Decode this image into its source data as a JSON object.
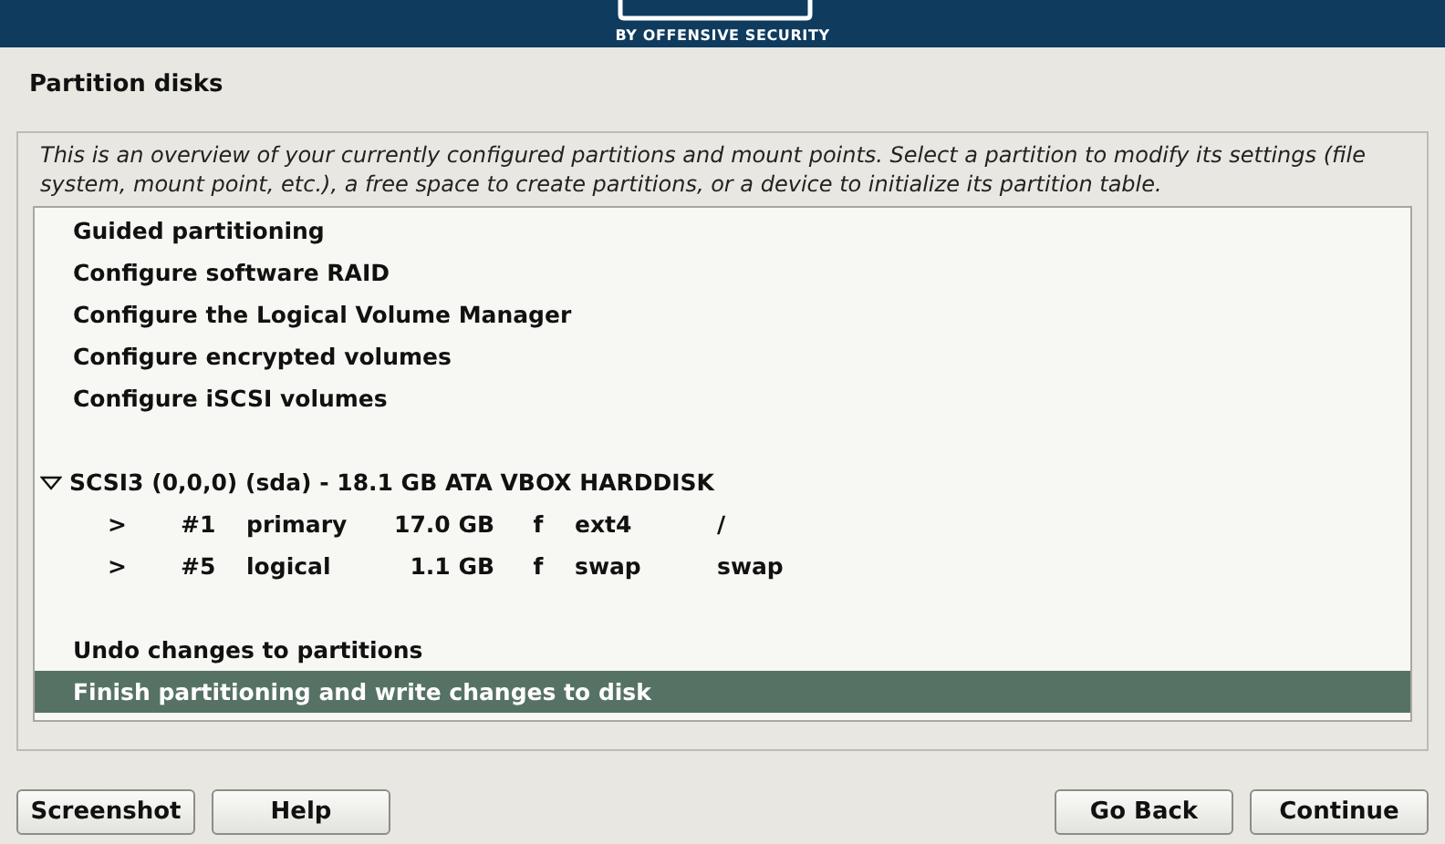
{
  "banner": {
    "tagline": "BY OFFENSIVE SECURITY"
  },
  "title": "Partition disks",
  "description": "This is an overview of your currently configured partitions and mount points. Select a partition to modify its settings (file system, mount point, etc.), a free space to create partitions, or a device to initialize its partition table.",
  "groups": [
    [
      {
        "kind": "option",
        "label": "Guided partitioning",
        "selected": false
      },
      {
        "kind": "option",
        "label": "Configure software RAID",
        "selected": false
      },
      {
        "kind": "option",
        "label": "Configure the Logical Volume Manager",
        "selected": false
      },
      {
        "kind": "option",
        "label": "Configure encrypted volumes",
        "selected": false
      },
      {
        "kind": "option",
        "label": "Configure iSCSI volumes",
        "selected": false
      }
    ],
    [
      {
        "kind": "disk",
        "label": "SCSI3 (0,0,0) (sda) - 18.1 GB ATA VBOX HARDDISK",
        "expanded": true,
        "selected": false,
        "children": [
          {
            "kind": "partition",
            "marker": ">",
            "number": "#1",
            "type": "primary",
            "size": "17.0 GB",
            "flag": "f",
            "filesystem": "ext4",
            "mount": "/",
            "selected": false
          },
          {
            "kind": "partition",
            "marker": ">",
            "number": "#5",
            "type": "logical",
            "size": "1.1 GB",
            "flag": "f",
            "filesystem": "swap",
            "mount": "swap",
            "selected": false
          }
        ]
      }
    ],
    [
      {
        "kind": "option",
        "label": "Undo changes to partitions",
        "selected": false
      },
      {
        "kind": "option",
        "label": "Finish partitioning and write changes to disk",
        "selected": true
      }
    ]
  ],
  "buttons_left": [
    "Screenshot",
    "Help"
  ],
  "buttons_right": [
    "Go Back",
    "Continue"
  ]
}
